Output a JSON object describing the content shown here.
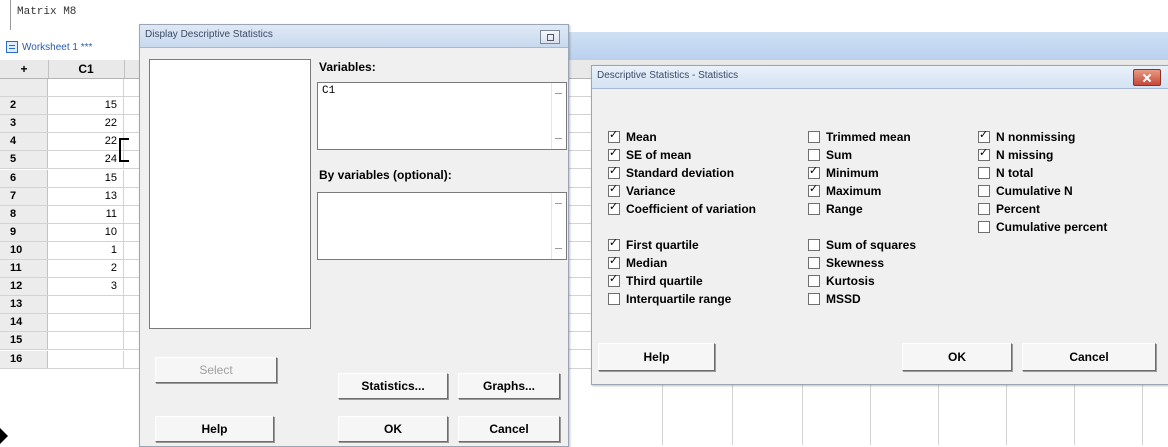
{
  "session": {
    "text": "Matrix M8"
  },
  "worksheet": {
    "title": "Worksheet 1 ***",
    "col_header_plus": "+",
    "col_header_c1": "C1",
    "rows": [
      {
        "n": "",
        "v": ""
      },
      {
        "n": "2",
        "v": "15"
      },
      {
        "n": "3",
        "v": "22"
      },
      {
        "n": "4",
        "v": "22"
      },
      {
        "n": "5",
        "v": "24"
      },
      {
        "n": "6",
        "v": "15"
      },
      {
        "n": "7",
        "v": "13"
      },
      {
        "n": "8",
        "v": "11"
      },
      {
        "n": "9",
        "v": "10"
      },
      {
        "n": "10",
        "v": "1"
      },
      {
        "n": "11",
        "v": "2"
      },
      {
        "n": "12",
        "v": "3"
      },
      {
        "n": "13",
        "v": ""
      },
      {
        "n": "14",
        "v": ""
      },
      {
        "n": "15",
        "v": ""
      },
      {
        "n": "16",
        "v": ""
      }
    ]
  },
  "display_descriptive_dialog": {
    "title": "Display Descriptive Statistics",
    "variables_label": "Variables:",
    "variables_value": "C1",
    "byvars_label": "By variables (optional):",
    "byvars_value": "",
    "select_label": "Select",
    "help_label": "Help",
    "statistics_label": "Statistics...",
    "graphs_label": "Graphs...",
    "ok_label": "OK",
    "cancel_label": "Cancel"
  },
  "statistics_dialog": {
    "title": "Descriptive Statistics - Statistics",
    "options": {
      "mean": {
        "label": "Mean",
        "checked": true
      },
      "se_mean": {
        "label": "SE of mean",
        "checked": true
      },
      "std_dev": {
        "label": "Standard deviation",
        "checked": true
      },
      "variance": {
        "label": "Variance",
        "checked": true
      },
      "coef_var": {
        "label": "Coefficient of variation",
        "checked": true
      },
      "first_quartile": {
        "label": "First quartile",
        "checked": true
      },
      "median": {
        "label": "Median",
        "checked": true
      },
      "third_quartile": {
        "label": "Third quartile",
        "checked": true
      },
      "iqr": {
        "label": "Interquartile range",
        "checked": false
      },
      "trimmed_mean": {
        "label": "Trimmed mean",
        "checked": false
      },
      "sum": {
        "label": "Sum",
        "checked": false
      },
      "minimum": {
        "label": "Minimum",
        "checked": true
      },
      "maximum": {
        "label": "Maximum",
        "checked": true
      },
      "range": {
        "label": "Range",
        "checked": false
      },
      "sum_squares": {
        "label": "Sum of squares",
        "checked": false
      },
      "skewness": {
        "label": "Skewness",
        "checked": false
      },
      "kurtosis": {
        "label": "Kurtosis",
        "checked": false
      },
      "mssd": {
        "label": "MSSD",
        "checked": false
      },
      "n_nonmissing": {
        "label": "N nonmissing",
        "checked": true
      },
      "n_missing": {
        "label": "N missing",
        "checked": true
      },
      "n_total": {
        "label": "N total",
        "checked": false
      },
      "cumulative_n": {
        "label": "Cumulative N",
        "checked": false
      },
      "percent": {
        "label": "Percent",
        "checked": false
      },
      "cumulative_percent": {
        "label": "Cumulative percent",
        "checked": false
      }
    },
    "help_label": "Help",
    "ok_label": "OK",
    "cancel_label": "Cancel"
  }
}
